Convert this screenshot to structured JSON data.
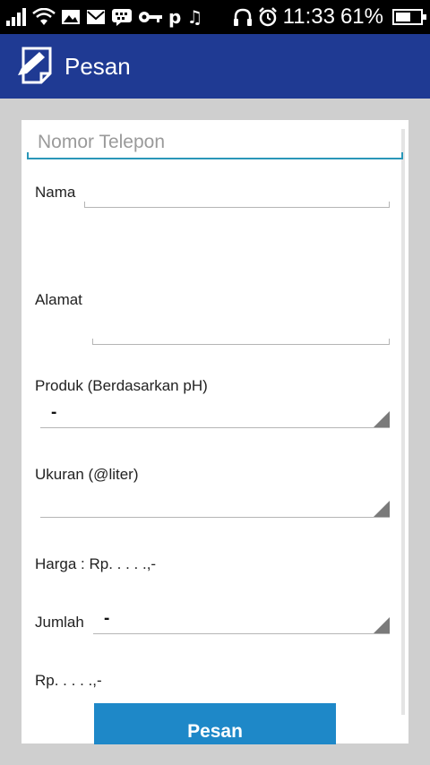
{
  "status_bar": {
    "time": "11:33",
    "battery_percent": "61%",
    "battery_level": 0.61,
    "icons_left": [
      "signal-icon",
      "wifi-icon",
      "image-icon",
      "mail-icon",
      "bbm-icon",
      "key-icon",
      "p-icon",
      "music-icon"
    ],
    "icons_right": [
      "headphones-icon",
      "alarm-icon"
    ]
  },
  "action_bar": {
    "title": "Pesan",
    "icon": "edit-note-icon",
    "color": "#1f3a93"
  },
  "form": {
    "phone_placeholder": "Nomor Telepon",
    "name_label": "Nama",
    "address_label": "Alamat",
    "product_label": "Produk (Berdasarkan pH)",
    "product_value": "-",
    "size_label": "Ukuran (@liter)",
    "size_value": "",
    "price_text": "Harga : Rp. . . . .,-",
    "quantity_label": "Jumlah",
    "quantity_value": "-",
    "total_text": "Rp. . . . .,-",
    "submit_label": "Pesan",
    "accent_color": "#2a97b8",
    "button_color": "#1e88c8"
  }
}
